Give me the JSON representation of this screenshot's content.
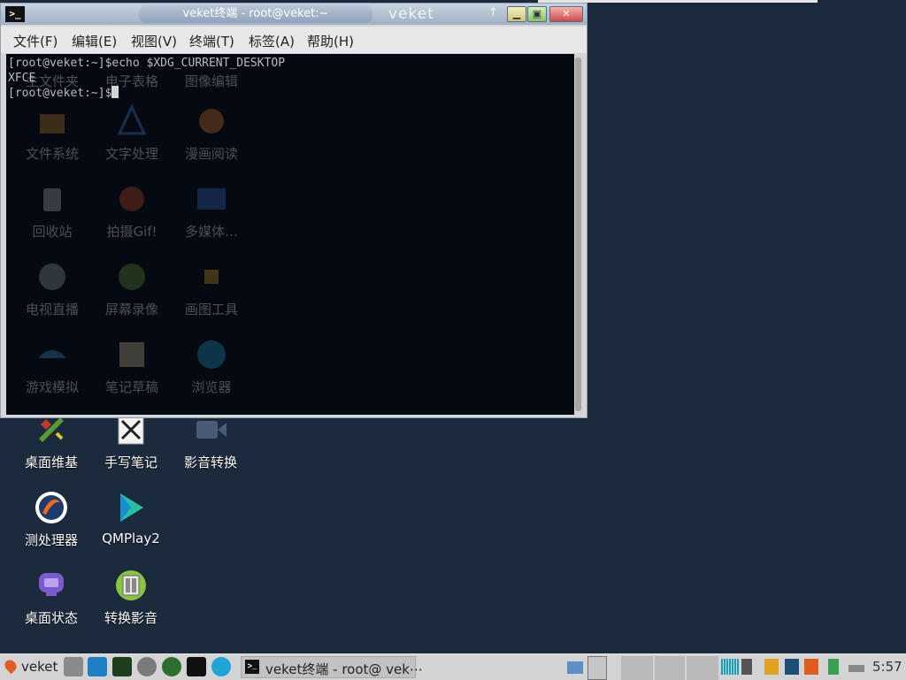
{
  "window": {
    "title": "veket终端 - root@veket:~",
    "wm_label": "veket",
    "menu": [
      "文件(F)",
      "编辑(E)",
      "视图(V)",
      "终端(T)",
      "标签(A)",
      "帮助(H)"
    ],
    "terminal_lines": [
      "[root@veket:~]$echo $XDG_CURRENT_DESKTOP",
      "XFCE",
      "[root@veket:~]$"
    ]
  },
  "desktop_icons": [
    {
      "label": "主文件夹",
      "icon": "home-folder-icon"
    },
    {
      "label": "电子表格",
      "icon": "spreadsheet-icon"
    },
    {
      "label": "图像编辑",
      "icon": "image-editor-icon"
    },
    {
      "label": "文件系统",
      "icon": "filesystem-icon"
    },
    {
      "label": "文字处理",
      "icon": "word-processor-icon"
    },
    {
      "label": "漫画阅读",
      "icon": "comic-reader-icon"
    },
    {
      "label": "回收站",
      "icon": "trash-icon"
    },
    {
      "label": "拍摄Gif!",
      "icon": "gif-capture-icon"
    },
    {
      "label": "多媒体…",
      "icon": "multimedia-icon"
    },
    {
      "label": "电视直播",
      "icon": "tv-live-icon"
    },
    {
      "label": "屏幕录像",
      "icon": "screen-record-icon"
    },
    {
      "label": "画图工具",
      "icon": "paint-tool-icon"
    },
    {
      "label": "游戏模拟",
      "icon": "game-emulator-icon"
    },
    {
      "label": "笔记草稿",
      "icon": "notes-draft-icon"
    },
    {
      "label": "浏览器",
      "icon": "browser-icon"
    },
    {
      "label": "桌面维基",
      "icon": "desktop-wiki-icon"
    },
    {
      "label": "手写笔记",
      "icon": "handwriting-notes-icon"
    },
    {
      "label": "影音转换",
      "icon": "media-convert-icon"
    },
    {
      "label": "测处理器",
      "icon": "cpu-test-icon"
    },
    {
      "label": "QMPlay2",
      "icon": "qmplay2-icon"
    },
    {
      "label": "桌面状态",
      "icon": "desktop-status-icon"
    },
    {
      "label": "转换影音",
      "icon": "convert-media-icon"
    }
  ],
  "taskbar": {
    "start_label": "veket",
    "task_title": "veket终端 - root@ vek⋯",
    "clock": "5:57"
  }
}
